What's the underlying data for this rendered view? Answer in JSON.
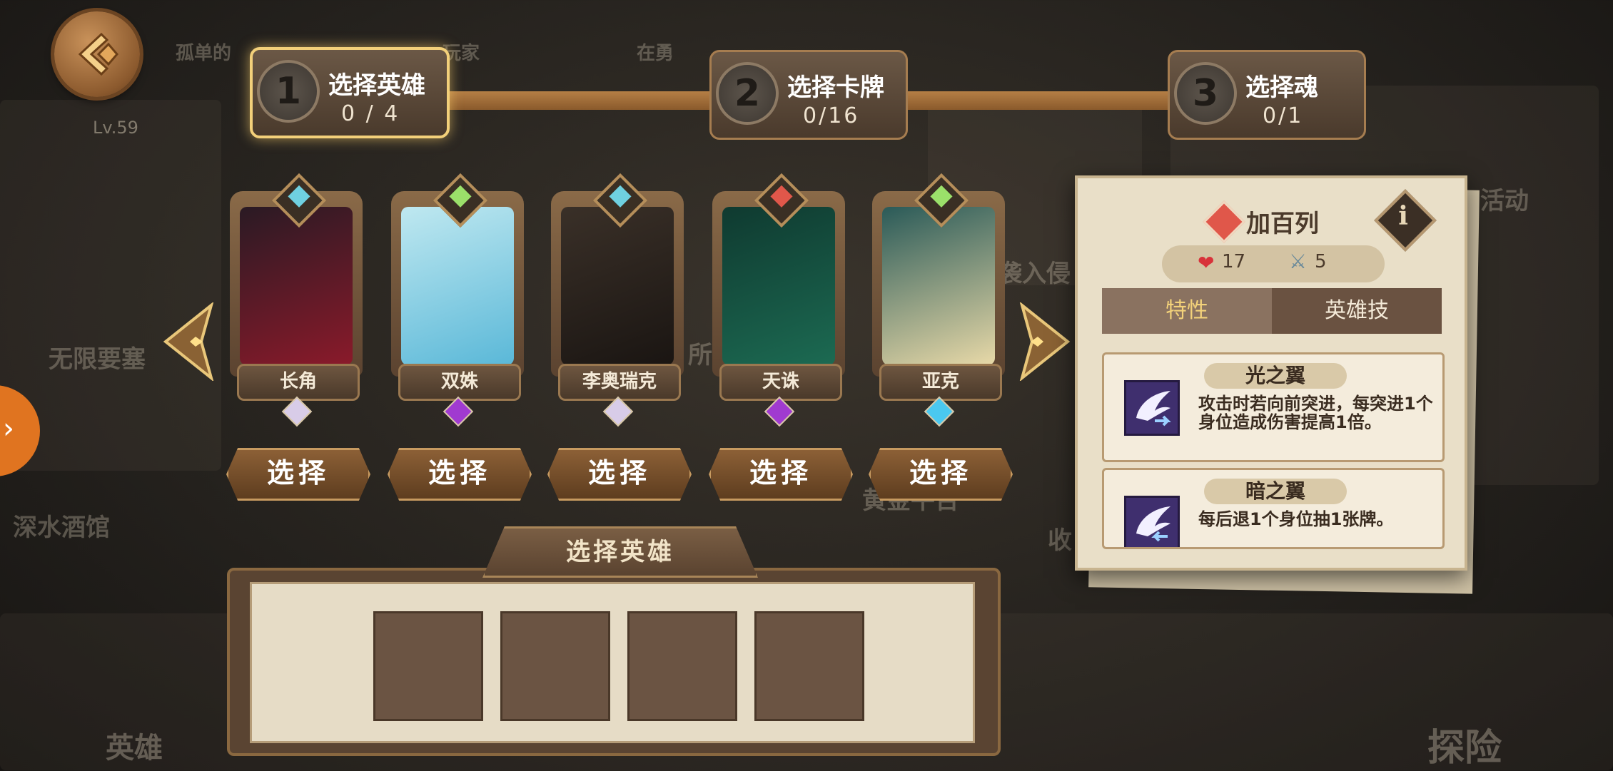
{
  "background_labels": {
    "top_banner": "孤单的",
    "top_banner2": "玩家",
    "top_banner3": "在勇",
    "wuxian": "无限要塞",
    "shenshui": "深水酒馆",
    "huodong": "活动",
    "ruqin": "袭入侵",
    "shou": "收",
    "suo": "所",
    "huangjin": "黄金平台",
    "hero_nav": "英雄",
    "explore_nav": "探险"
  },
  "player": {
    "level": "Lv.59"
  },
  "steps": [
    {
      "number": "1",
      "title": "选择英雄",
      "count": "0 / 4",
      "active": true
    },
    {
      "number": "2",
      "title": "选择卡牌",
      "count": "0/16",
      "active": false
    },
    {
      "number": "3",
      "title": "选择魂",
      "count": "0/1",
      "active": false
    }
  ],
  "heroes": [
    {
      "name": "长角",
      "select_label": "选择",
      "class_color": "#6fd0e0",
      "rarity_color": "#d8cce8",
      "art_colors": [
        "#2a1a24",
        "#8a1a2a"
      ]
    },
    {
      "name": "双姝",
      "select_label": "选择",
      "class_color": "#9be06a",
      "rarity_color": "#a03ad0",
      "art_colors": [
        "#bfe8f0",
        "#5ab8d8"
      ]
    },
    {
      "name": "李奥瑞克",
      "select_label": "选择",
      "class_color": "#6fd0e0",
      "rarity_color": "#d8cce8",
      "art_colors": [
        "#3a3028",
        "#1a1512"
      ]
    },
    {
      "name": "天诛",
      "select_label": "选择",
      "class_color": "#e0574a",
      "rarity_color": "#a03ad0",
      "art_colors": [
        "#0f3a30",
        "#1c6a52"
      ]
    },
    {
      "name": "亚克",
      "select_label": "选择",
      "class_color": "#9be06a",
      "rarity_color": "#4ac8f0",
      "art_colors": [
        "#2a5a58",
        "#e8d9a8"
      ]
    }
  ],
  "bottom_panel": {
    "title": "选择英雄",
    "slots": 4
  },
  "detail": {
    "hero_name": "加百列",
    "hp": "17",
    "power": "5",
    "tabs": [
      "特性",
      "英雄技"
    ],
    "skills": [
      {
        "name": "光之翼",
        "desc": "攻击时若向前突进，每突进1个身位造成伤害提高1倍。"
      },
      {
        "name": "暗之翼",
        "desc": "每后退1个身位抽1张牌。"
      }
    ]
  },
  "icons": {
    "back": "back-arrow-icon",
    "prev": "chevron-left-icon",
    "next": "chevron-right-icon",
    "info": "info-icon",
    "heart": "heart-icon",
    "sword": "sword-icon",
    "wing": "wing-icon"
  }
}
